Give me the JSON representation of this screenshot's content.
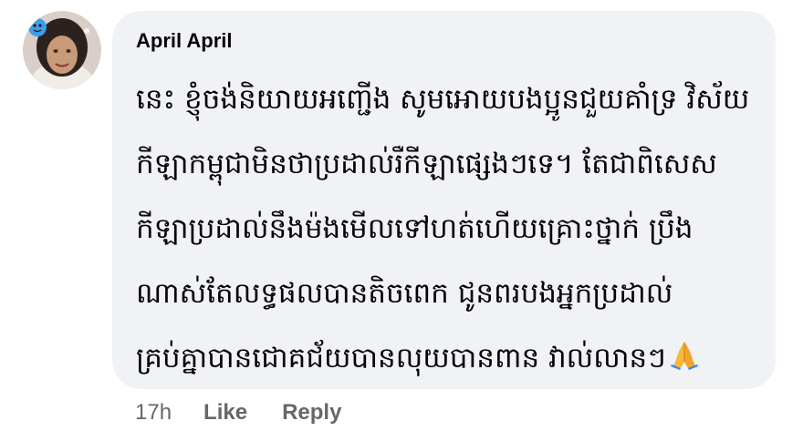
{
  "comment": {
    "author": "April April",
    "lines": [
      "នេះ ខ្ញុំចង់និយាយអញ្ជើង សូមអោយបងប្អូនជួយគាំទ្រ វិស័យ",
      "កីឡាកម្ពុជាមិនថាប្រដាល់រឺកីឡាផ្សេងៗទេ។ តែជាពិសេស",
      "កីឡាប្រដាល់នឹងម៉ងមើលទៅហត់ហើយគ្រោះថ្នាក់ ប្រឹង",
      "ណាស់តែលទ្ធផលបានតិចពេក ជូនពរបងអ្នកប្រដាល់",
      "គ្រប់គ្នាបានជោគជ័យបានលុយបានពាន វាល់លានៗ"
    ],
    "emoji": "folded-hands-emoji",
    "timestamp": "17h",
    "like_label": "Like",
    "reply_label": "Reply"
  },
  "colors": {
    "bubble_bg": "#f0f2f5",
    "text": "#050505",
    "secondary_text": "#65676b"
  }
}
